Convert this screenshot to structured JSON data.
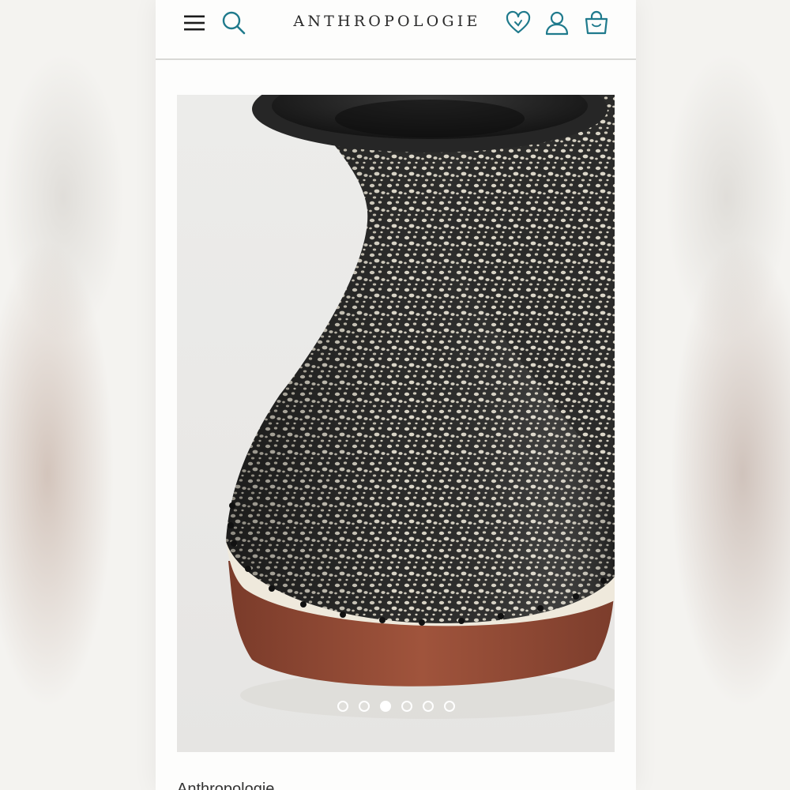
{
  "header": {
    "logo_text": "ANTHROPOLOGIE",
    "icons": {
      "menu": "hamburger-menu-icon",
      "search": "search-icon",
      "wishlist": "heart-icon",
      "account": "user-icon",
      "bag": "shopping-bag-icon"
    },
    "accent_color": "#1f7a8c"
  },
  "gallery": {
    "image_count": 6,
    "active_index": 2,
    "image_subject": "speckled black and cream ceramic vase with terracotta base"
  },
  "product": {
    "brand_peek": "Anthropologie"
  }
}
